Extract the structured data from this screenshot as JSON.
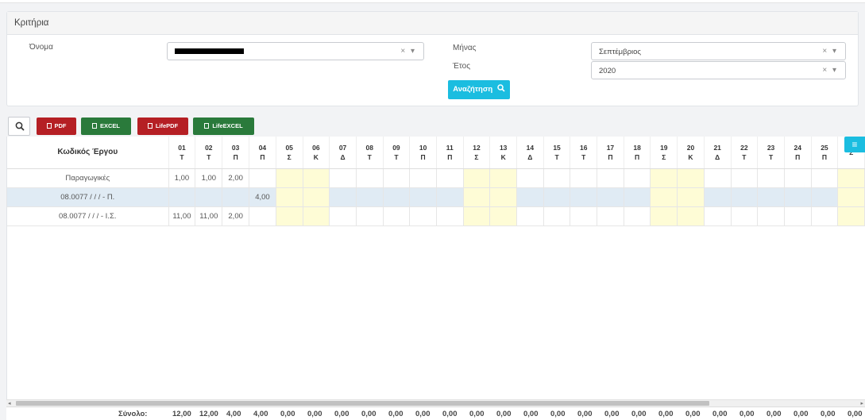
{
  "criteria": {
    "title": "Κριτήρια",
    "name_label": "Όνομα",
    "month_label": "Μήνας",
    "year_label": "Έτος",
    "month_value": "Σεπτέμβριος",
    "year_value": "2020",
    "clear_symbol": "×",
    "dropdown_symbol": "▾",
    "search_label": "Αναζήτηση"
  },
  "toolbar": {
    "pdf_label": "PDF",
    "excel_label": "EXCEL",
    "lifepdf_label": "LifePDF",
    "lifeexcel_label": "LifeEXCEL"
  },
  "colors": {
    "accent": "#1bbde0",
    "pdf": "#b51f24",
    "excel": "#2a7a3b",
    "weekend": "#fefcd6",
    "row_highlight": "#e0ebf4"
  },
  "table": {
    "code_header": "Κωδικός Έργου",
    "days": [
      {
        "num": "01",
        "dow": "Τ"
      },
      {
        "num": "02",
        "dow": "Τ"
      },
      {
        "num": "03",
        "dow": "Π"
      },
      {
        "num": "04",
        "dow": "Π"
      },
      {
        "num": "05",
        "dow": "Σ"
      },
      {
        "num": "06",
        "dow": "Κ"
      },
      {
        "num": "07",
        "dow": "Δ"
      },
      {
        "num": "08",
        "dow": "Τ"
      },
      {
        "num": "09",
        "dow": "Τ"
      },
      {
        "num": "10",
        "dow": "Π"
      },
      {
        "num": "11",
        "dow": "Π"
      },
      {
        "num": "12",
        "dow": "Σ"
      },
      {
        "num": "13",
        "dow": "Κ"
      },
      {
        "num": "14",
        "dow": "Δ"
      },
      {
        "num": "15",
        "dow": "Τ"
      },
      {
        "num": "16",
        "dow": "Τ"
      },
      {
        "num": "17",
        "dow": "Π"
      },
      {
        "num": "18",
        "dow": "Π"
      },
      {
        "num": "19",
        "dow": "Σ"
      },
      {
        "num": "20",
        "dow": "Κ"
      },
      {
        "num": "21",
        "dow": "Δ"
      },
      {
        "num": "22",
        "dow": "Τ"
      },
      {
        "num": "23",
        "dow": "Τ"
      },
      {
        "num": "24",
        "dow": "Π"
      },
      {
        "num": "25",
        "dow": "Π"
      },
      {
        "num": "",
        "dow": "Σ"
      }
    ],
    "weekend_columns": [
      4,
      5,
      11,
      12,
      18,
      19,
      25
    ],
    "rows": [
      {
        "code": "Παραγωγικές",
        "values": [
          "1,00",
          "1,00",
          "2,00"
        ],
        "highlight": false
      },
      {
        "code": "08.0077 / / / - Π.",
        "values": [
          "",
          "",
          "",
          "4,00"
        ],
        "highlight": true
      },
      {
        "code": "08.0077 / / / - Ι.Σ.",
        "values": [
          "11,00",
          "11,00",
          "2,00"
        ],
        "highlight": false
      }
    ]
  },
  "footer": {
    "label": "Σύνολο:",
    "totals": [
      "12,00",
      "12,00",
      "4,00",
      "4,00",
      "0,00",
      "0,00",
      "0,00",
      "0,00",
      "0,00",
      "0,00",
      "0,00",
      "0,00",
      "0,00",
      "0,00",
      "0,00",
      "0,00",
      "0,00",
      "0,00",
      "0,00",
      "0,00",
      "0,00",
      "0,00",
      "0,00",
      "0,00",
      "0,00",
      "0,00"
    ]
  }
}
